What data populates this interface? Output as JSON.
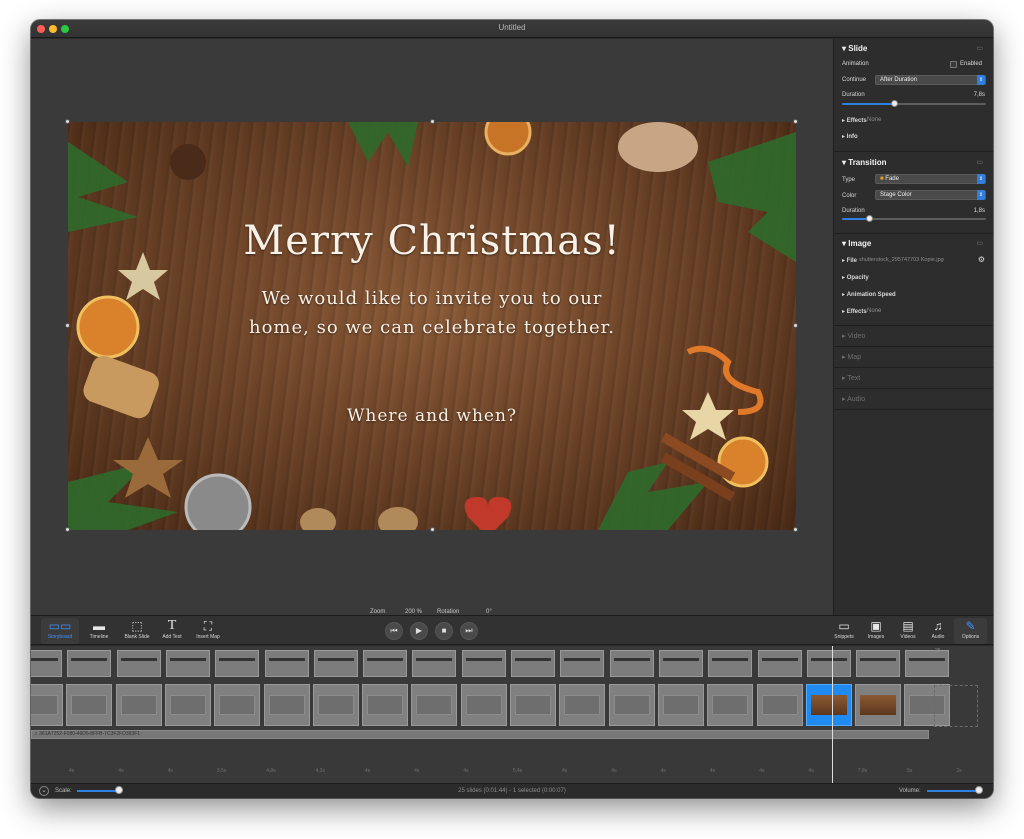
{
  "window": {
    "title": "Untitled"
  },
  "slide": {
    "title": "Merry Christmas!",
    "line1": "We would like to invite you to our",
    "line2": "home, so we can celebrate together.",
    "line3": "Where and when?"
  },
  "stage_controls": {
    "zoom_label": "Zoom",
    "zoom_value": "200 %",
    "rotation_label": "Rotation",
    "rotation_value": "0°"
  },
  "inspector": {
    "slide": {
      "title": "Slide",
      "animation_label": "Animation",
      "enabled_label": "Enabled",
      "enabled_checked": false,
      "continue_label": "Continue",
      "continue_value": "After Duration",
      "duration_label": "Duration",
      "duration_value": "7,8s",
      "effects_label": "Effects",
      "effects_value": "None",
      "info_label": "Info"
    },
    "transition": {
      "title": "Transition",
      "type_label": "Type",
      "type_value": "Fade",
      "color_label": "Color",
      "color_value": "Stage Color",
      "duration_label": "Duration",
      "duration_value": "1,8s"
    },
    "image": {
      "title": "Image",
      "file_label": "File",
      "file_value": "shutterstock_295747703 Kopie.jpg",
      "opacity_label": "Opacity",
      "animation_speed_label": "Animation Speed",
      "effects_label": "Effects",
      "effects_value": "None"
    },
    "collapsed": [
      "Video",
      "Map",
      "Text",
      "Audio"
    ]
  },
  "toolbar": {
    "left": [
      {
        "label": "Storyboard",
        "icon": "storyboard-icon"
      },
      {
        "label": "Timeline",
        "icon": "timeline-icon"
      },
      {
        "label": "Blank Slide",
        "icon": "blank-slide-icon"
      },
      {
        "label": "Add Text",
        "icon": "text-icon"
      },
      {
        "label": "Insert Map",
        "icon": "map-icon"
      }
    ],
    "transport": [
      "rewind",
      "play",
      "stop",
      "fast-forward"
    ],
    "right": [
      {
        "label": "Snippets",
        "icon": "snippets-icon"
      },
      {
        "label": "Images",
        "icon": "images-icon"
      },
      {
        "label": "Videos",
        "icon": "videos-icon"
      },
      {
        "label": "Audio",
        "icon": "audio-icon"
      },
      {
        "label": "Options",
        "icon": "wrench-icon"
      }
    ]
  },
  "timeline": {
    "audio_track_label": "♫ 361A7252-F080-46D5-8FFB-7C3F2FD393F1",
    "ruler": [
      "4s",
      "4s",
      "4s",
      "3,5s",
      "4,8s",
      "4,3s",
      "4s",
      "4s",
      "4s",
      "5,4s",
      "4s",
      "4s",
      "4s",
      "4s",
      "4s",
      "4s",
      "7,8s",
      "5s",
      "2s"
    ],
    "end_marker": "25"
  },
  "statusbar": {
    "scale_label": "Scale:",
    "summary": "25 slides (0:01:44) - 1 selected (0:00:07)",
    "volume_label": "Volume:"
  },
  "colors": {
    "accent": "#2f7fe0",
    "window_bg": "#2a2a2a",
    "inspector_bg": "#2d2d2d"
  }
}
